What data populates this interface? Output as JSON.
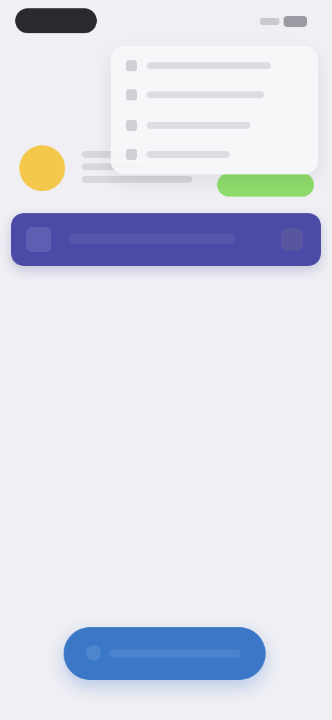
{
  "status_bar": {},
  "page": {
    "title": ""
  },
  "profile": {
    "action_label": ""
  },
  "banner": {
    "text": ""
  },
  "menu": {
    "items": [
      "",
      "",
      "",
      ""
    ]
  },
  "bottom_button": {
    "label": ""
  },
  "colors": {
    "background": "#efeff4",
    "banner": "#4b4aa6",
    "avatar": "#f4c84a",
    "action_pill": "#8fdc6d",
    "primary_button": "#3a77c6"
  }
}
